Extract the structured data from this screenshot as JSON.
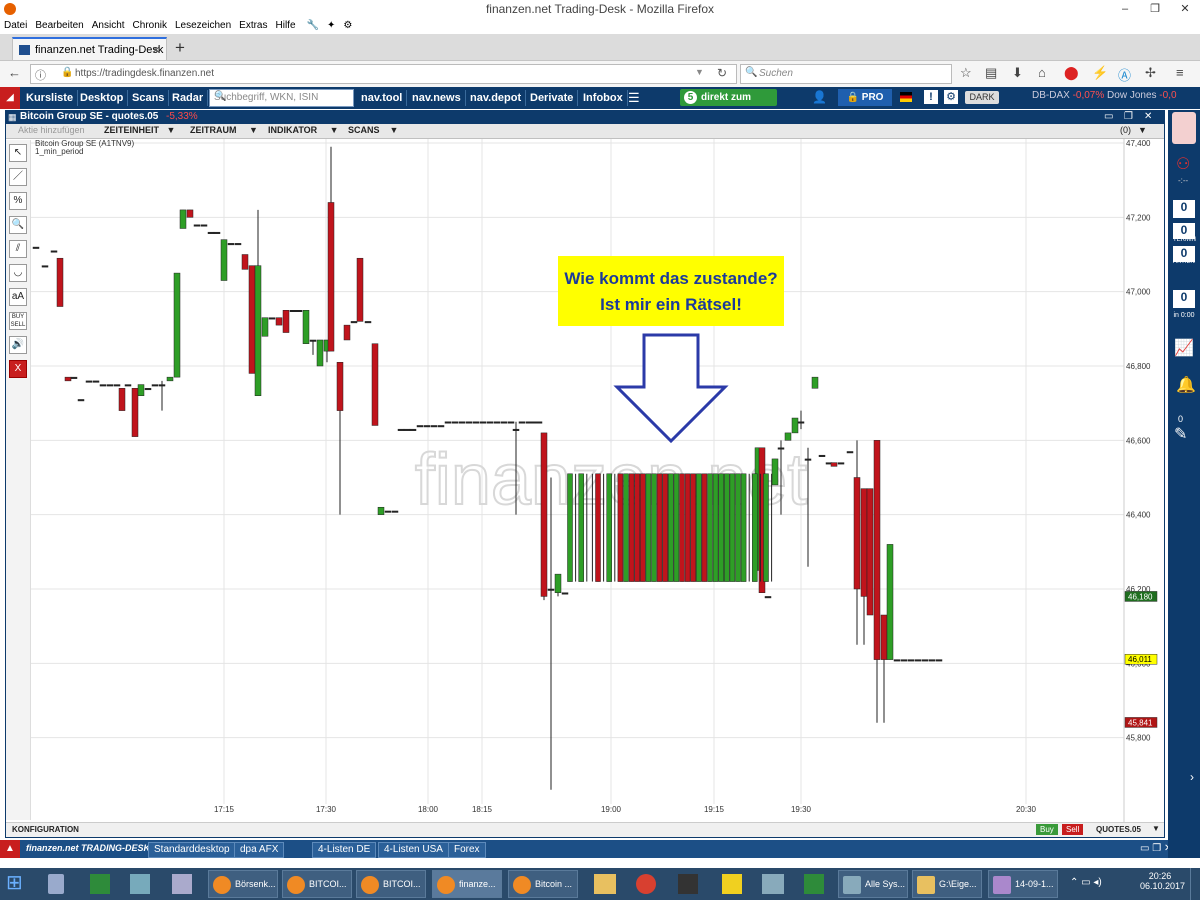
{
  "browser": {
    "window_title": "finanzen.net Trading-Desk - Mozilla Firefox",
    "menu": [
      "Datei",
      "Bearbeiten",
      "Ansicht",
      "Chronik",
      "Lesezeichen",
      "Extras",
      "Hilfe"
    ],
    "tab_title": "finanzen.net Trading-Desk",
    "url": "https://tradingdesk.finanzen.net",
    "search_placeholder": "Suchen"
  },
  "app": {
    "nav_items": [
      "Kursliste",
      "Desktop",
      "Scans",
      "Radar"
    ],
    "search_placeholder": "Suchbegriff, WKN, ISIN",
    "nav_items2": [
      "nav.tool",
      "nav.news",
      "nav.depot",
      "Derivate",
      "Infobox"
    ],
    "depot_button": "direkt zum Depot",
    "depot_number": "5",
    "pro_label": "PRO",
    "dark_label": "DARK",
    "ticker": [
      {
        "name": "DB-DAX",
        "change": "-0,07%"
      },
      {
        "name": "Dow Jones",
        "change": "-0,0"
      }
    ]
  },
  "chart_window": {
    "title": "Bitcoin Group SE - quotes.05",
    "change": "-5,33%",
    "menu": [
      "Aktie hinzufügen",
      "ZEITEINHEIT",
      "ZEITRAUM",
      "INDIKATOR",
      "SCANS"
    ],
    "counter": "(0)",
    "instrument": "Bitcoin Group SE (A1TNV9)",
    "period": "1_min_period",
    "watermark": "finanzen.net",
    "annotation_line1": "Wie kommt das zustande?",
    "annotation_line2": "Ist mir ein Rätsel!",
    "price_tags": [
      {
        "value": "46,180",
        "color": "#1f6e1f"
      },
      {
        "value": "46,011",
        "color": "#ffff00"
      },
      {
        "value": "45,841",
        "color": "#b01515"
      }
    ],
    "status_left": "KONFIGURATION",
    "buy": "Buy",
    "sell": "Sell",
    "status_right": "QUOTES.05"
  },
  "desktop_tabs": [
    "Standarddesktop",
    "dpa AFX",
    "4-Listen DE",
    "4-Listen USA",
    "Forex"
  ],
  "desk_brand": "finanzen.net TRADING-DESK",
  "right_panel": {
    "news_count": "0",
    "news_label": "NEWS",
    "termin_count": "0",
    "termin_label": "TERMIN",
    "aktien_count": "0",
    "aktien_label": "AKTIEN",
    "events_count": "0",
    "events_sub": "in 0:00",
    "notes_count": "0"
  },
  "taskbar": {
    "tasks": [
      "Börsenk...",
      "BITCOI...",
      "BITCOI...",
      "finanze...",
      "Bitcoin ...",
      "Alle Sys...",
      "G:\\Eige...",
      "14-09-1..."
    ],
    "time": "20:26",
    "date": "06.10.2017"
  },
  "chart_data": {
    "type": "candlestick",
    "y_ticks": [
      "47,400",
      "47,200",
      "47,000",
      "46,800",
      "46,600",
      "46,400",
      "46,200",
      "46,000",
      "45,800"
    ],
    "x_ticks": [
      "17:15",
      "17:30",
      "18:00",
      "18:15",
      "19:00",
      "19:15",
      "19:30",
      "20:30"
    ],
    "ylim": [
      45.6,
      47.4
    ],
    "candles": [
      [
        36,
        47.12,
        47.12,
        47.12,
        47.12
      ],
      [
        45,
        47.07,
        47.07,
        47.07,
        47.07
      ],
      [
        54,
        47.11,
        47.11,
        47.11,
        47.11
      ],
      [
        60,
        47.09,
        46.96,
        47.09,
        46.96
      ],
      [
        68,
        46.77,
        46.76,
        46.77,
        46.76
      ],
      [
        74,
        46.77,
        46.77,
        46.77,
        46.77
      ],
      [
        81,
        46.71,
        46.71,
        46.71,
        46.71
      ],
      [
        89,
        46.76,
        46.76,
        46.76,
        46.76
      ],
      [
        96,
        46.76,
        46.76,
        46.76,
        46.76
      ],
      [
        103,
        46.75,
        46.75,
        46.75,
        46.75
      ],
      [
        110,
        46.75,
        46.75,
        46.75,
        46.75
      ],
      [
        117,
        46.75,
        46.75,
        46.75,
        46.75
      ],
      [
        122,
        46.74,
        46.68,
        46.74,
        46.68
      ],
      [
        128,
        46.75,
        46.75,
        46.75,
        46.75
      ],
      [
        135,
        46.74,
        46.61,
        46.74,
        46.61
      ],
      [
        141,
        46.72,
        46.75,
        46.72,
        46.75
      ],
      [
        148,
        46.74,
        46.74,
        46.74,
        46.74
      ],
      [
        155,
        46.75,
        46.75,
        46.75,
        46.75
      ],
      [
        162,
        46.75,
        46.75,
        46.76,
        46.68
      ],
      [
        170,
        46.76,
        46.77,
        46.77,
        46.76
      ],
      [
        177,
        46.77,
        47.05,
        47.05,
        46.77
      ],
      [
        183,
        47.17,
        47.22,
        47.22,
        47.17
      ],
      [
        190,
        47.22,
        47.2,
        47.22,
        47.2
      ],
      [
        197,
        47.18,
        47.18,
        47.18,
        47.18
      ],
      [
        204,
        47.18,
        47.18,
        47.18,
        47.18
      ],
      [
        211,
        47.16,
        47.16,
        47.16,
        47.16
      ],
      [
        217,
        47.16,
        47.16,
        47.16,
        47.16
      ],
      [
        224,
        47.03,
        47.14,
        47.14,
        47.03
      ],
      [
        231,
        47.13,
        47.13,
        47.13,
        47.13
      ],
      [
        238,
        47.13,
        47.13,
        47.13,
        47.13
      ],
      [
        245,
        47.1,
        47.06,
        47.1,
        47.06
      ],
      [
        252,
        47.07,
        46.78,
        47.07,
        46.78
      ],
      [
        258,
        46.72,
        47.07,
        47.22,
        46.72
      ],
      [
        265,
        46.88,
        46.93,
        46.93,
        46.88
      ],
      [
        272,
        46.93,
        46.93,
        46.93,
        46.93
      ],
      [
        279,
        46.93,
        46.91,
        46.93,
        46.91
      ],
      [
        286,
        46.95,
        46.89,
        46.95,
        46.89
      ],
      [
        293,
        46.95,
        46.95,
        46.95,
        46.95
      ],
      [
        299,
        46.95,
        46.95,
        46.95,
        46.95
      ],
      [
        306,
        46.86,
        46.95,
        46.95,
        46.86
      ],
      [
        313,
        46.87,
        46.87,
        46.87,
        46.83
      ],
      [
        320,
        46.8,
        46.87,
        46.87,
        46.8
      ],
      [
        327,
        46.84,
        46.87,
        46.87,
        46.81
      ],
      [
        331,
        47.24,
        46.84,
        47.39,
        46.84
      ],
      [
        340,
        46.81,
        46.68,
        46.81,
        46.4
      ],
      [
        347,
        46.91,
        46.87,
        46.91,
        46.87
      ],
      [
        354,
        46.92,
        46.92,
        46.92,
        46.92
      ],
      [
        360,
        47.09,
        46.92,
        47.09,
        46.92
      ],
      [
        368,
        46.92,
        46.92,
        46.92,
        46.92
      ],
      [
        375,
        46.86,
        46.64,
        46.86,
        46.64
      ],
      [
        381,
        46.4,
        46.42,
        46.42,
        46.4
      ],
      [
        388,
        46.41,
        46.41,
        46.41,
        46.41
      ],
      [
        395,
        46.41,
        46.41,
        46.41,
        46.41
      ],
      [
        401,
        46.63,
        46.63,
        46.63,
        46.63
      ],
      [
        407,
        46.63,
        46.63,
        46.63,
        46.63
      ],
      [
        413,
        46.63,
        46.63,
        46.63,
        46.63
      ],
      [
        420,
        46.64,
        46.64,
        46.64,
        46.64
      ],
      [
        427,
        46.64,
        46.64,
        46.64,
        46.64
      ],
      [
        434,
        46.64,
        46.64,
        46.64,
        46.64
      ],
      [
        441,
        46.64,
        46.64,
        46.64,
        46.64
      ],
      [
        448,
        46.65,
        46.65,
        46.65,
        46.65
      ],
      [
        455,
        46.65,
        46.65,
        46.65,
        46.65
      ],
      [
        462,
        46.65,
        46.65,
        46.65,
        46.65
      ],
      [
        469,
        46.65,
        46.65,
        46.65,
        46.65
      ],
      [
        476,
        46.65,
        46.65,
        46.65,
        46.65
      ],
      [
        483,
        46.65,
        46.65,
        46.65,
        46.65
      ],
      [
        490,
        46.65,
        46.65,
        46.65,
        46.65
      ],
      [
        497,
        46.65,
        46.65,
        46.65,
        46.65
      ],
      [
        504,
        46.65,
        46.65,
        46.65,
        46.65
      ],
      [
        511,
        46.65,
        46.65,
        46.65,
        46.65
      ],
      [
        516,
        46.63,
        46.63,
        46.65,
        46.4
      ],
      [
        522,
        46.65,
        46.65,
        46.65,
        46.65
      ],
      [
        529,
        46.65,
        46.65,
        46.65,
        46.65
      ],
      [
        535,
        46.65,
        46.65,
        46.65,
        46.65
      ],
      [
        539,
        46.65,
        46.65,
        46.65,
        46.65
      ],
      [
        544,
        46.62,
        46.18,
        46.62,
        46.17
      ],
      [
        551,
        46.2,
        46.2,
        46.5,
        45.66
      ],
      [
        558,
        46.19,
        46.24,
        46.24,
        46.18
      ],
      [
        565,
        46.19,
        46.19,
        46.19,
        46.19
      ]
    ],
    "anomaly_region": {
      "x_from": "19:00",
      "x_to": "19:20",
      "price_high": 46.51,
      "price_low": 46.22
    },
    "candles_right": [
      [
        758,
        46.25,
        46.58,
        46.58,
        46.25
      ],
      [
        762,
        46.58,
        46.19,
        46.58,
        46.19
      ],
      [
        768,
        46.18,
        46.18,
        46.18,
        46.18
      ],
      [
        775,
        46.48,
        46.55,
        46.55,
        46.48
      ],
      [
        781,
        46.58,
        46.58,
        46.6,
        46.4
      ],
      [
        788,
        46.6,
        46.62,
        46.62,
        46.6
      ],
      [
        795,
        46.62,
        46.66,
        46.66,
        46.62
      ],
      [
        801,
        46.65,
        46.65,
        46.68,
        46.63
      ],
      [
        808,
        46.55,
        46.55,
        46.58,
        46.26
      ],
      [
        815,
        46.74,
        46.77,
        46.77,
        46.74
      ],
      [
        822,
        46.56,
        46.56,
        46.56,
        46.56
      ],
      [
        829,
        46.54,
        46.54,
        46.54,
        46.54
      ],
      [
        834,
        46.54,
        46.53,
        46.54,
        46.53
      ],
      [
        841,
        46.54,
        46.54,
        46.54,
        46.54
      ],
      [
        850,
        46.57,
        46.57,
        46.57,
        46.57
      ],
      [
        857,
        46.5,
        46.2,
        46.6,
        46.05
      ],
      [
        864,
        46.47,
        46.18,
        46.47,
        46.05
      ],
      [
        870,
        46.47,
        46.13,
        46.47,
        46.13
      ],
      [
        877,
        46.6,
        46.01,
        46.6,
        45.84
      ],
      [
        884,
        46.13,
        46.01,
        46.13,
        45.84
      ],
      [
        890,
        46.01,
        46.32,
        46.32,
        46.01
      ],
      [
        897,
        46.01,
        46.01,
        46.01,
        46.01
      ],
      [
        904,
        46.01,
        46.01,
        46.01,
        46.01
      ],
      [
        911,
        46.01,
        46.01,
        46.01,
        46.01
      ],
      [
        918,
        46.01,
        46.01,
        46.01,
        46.01
      ],
      [
        925,
        46.01,
        46.01,
        46.01,
        46.01
      ],
      [
        932,
        46.01,
        46.01,
        46.01,
        46.01
      ],
      [
        939,
        46.01,
        46.01,
        46.01,
        46.01
      ]
    ],
    "up_color": "#2e9e26",
    "down_color": "#c0141c",
    "grid": true
  }
}
